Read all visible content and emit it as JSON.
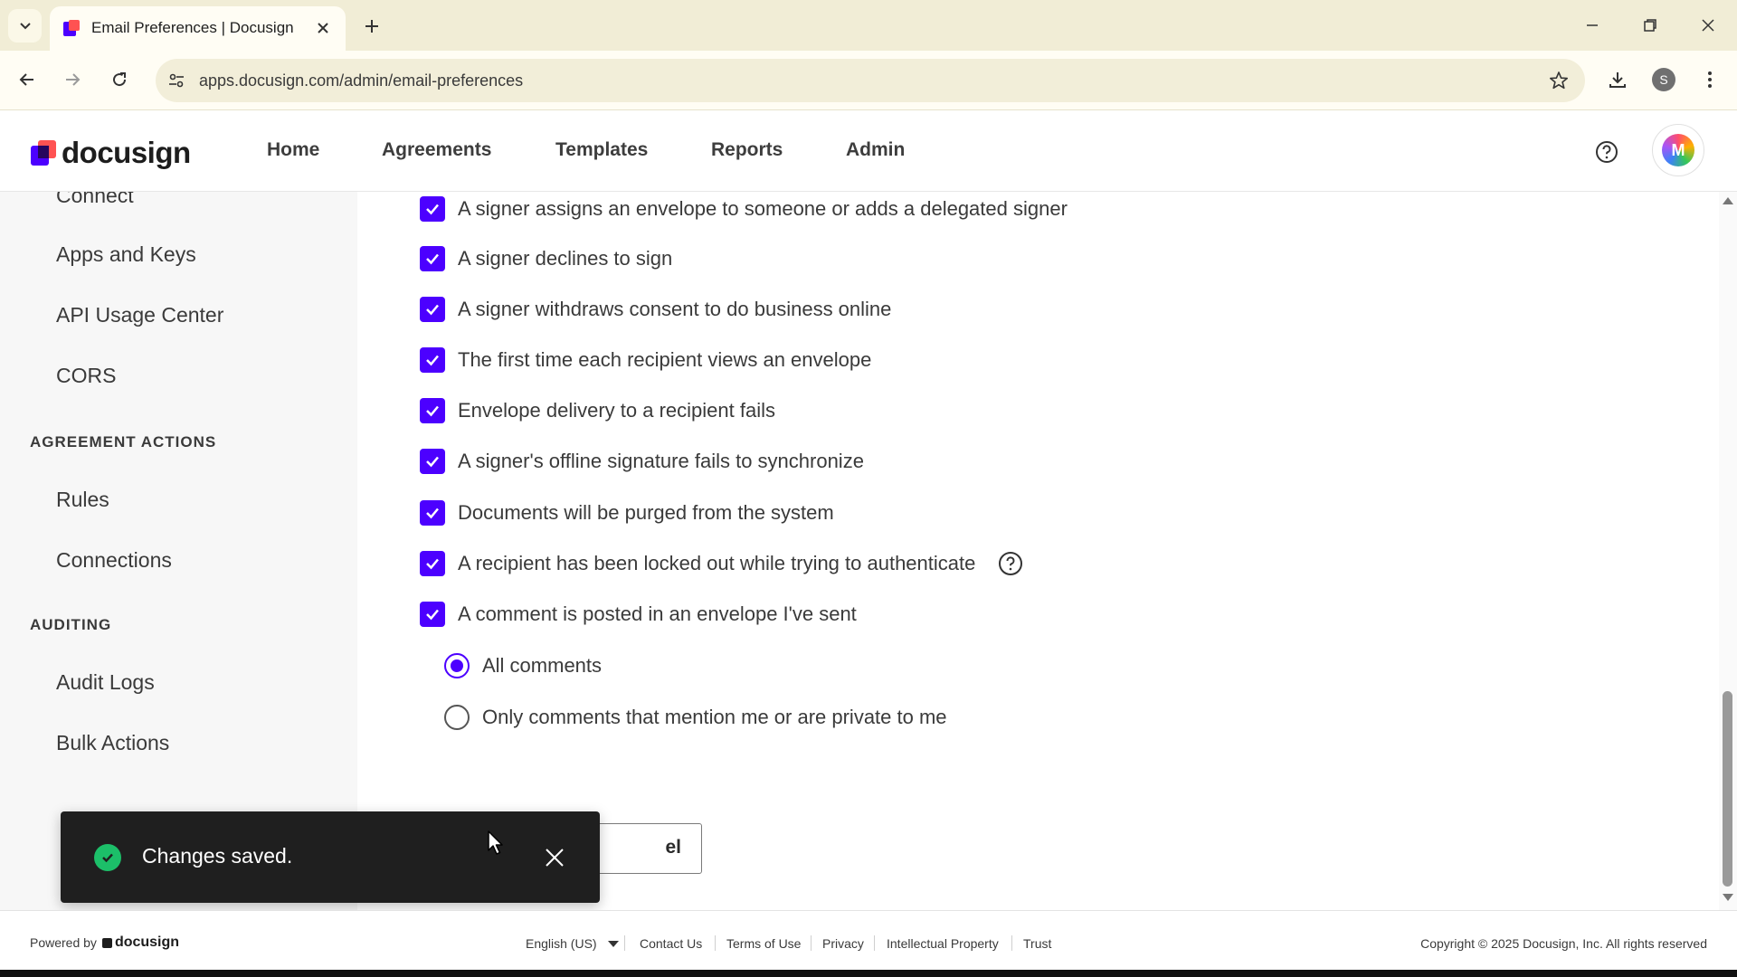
{
  "browser": {
    "tab_title": "Email Preferences | Docusign",
    "url": "apps.docusign.com/admin/email-preferences",
    "profile_initial": "S"
  },
  "header": {
    "logo_text": "docusign",
    "nav": [
      "Home",
      "Agreements",
      "Templates",
      "Reports",
      "Admin"
    ],
    "avatar_initial": "M"
  },
  "sidebar": {
    "items_top": [
      "Connect",
      "Apps and Keys",
      "API Usage Center",
      "CORS"
    ],
    "sections": [
      {
        "title": "AGREEMENT ACTIONS",
        "items": [
          "Rules",
          "Connections"
        ]
      },
      {
        "title": "AUDITING",
        "items": [
          "Audit Logs",
          "Bulk Actions"
        ]
      }
    ]
  },
  "main": {
    "options": [
      {
        "label": "A signer assigns an envelope to someone or adds a delegated signer",
        "checked": true
      },
      {
        "label": "A signer declines to sign",
        "checked": true
      },
      {
        "label": "A signer withdraws consent to do business online",
        "checked": true
      },
      {
        "label": "The first time each recipient views an envelope",
        "checked": true
      },
      {
        "label": "Envelope delivery to a recipient fails",
        "checked": true
      },
      {
        "label": "A signer's offline signature fails to synchronize",
        "checked": true
      },
      {
        "label": "Documents will be purged from the system",
        "checked": true
      },
      {
        "label": "A recipient has been locked out while trying to authenticate",
        "checked": true
      },
      {
        "label": "A comment is posted in an envelope I've sent",
        "checked": true
      }
    ],
    "comment_options": [
      {
        "label": "All comments",
        "selected": true
      },
      {
        "label": "Only comments that mention me or are private to me",
        "selected": false
      }
    ],
    "cancel_visible_text": "el"
  },
  "toast": {
    "message": "Changes saved."
  },
  "footer": {
    "powered_by": "Powered by",
    "logo_text": "docusign",
    "language": "English (US)",
    "links": [
      "Contact Us",
      "Terms of Use",
      "Privacy",
      "Intellectual Property",
      "Trust"
    ],
    "copyright": "Copyright © 2025 Docusign, Inc. All rights reserved"
  },
  "colors": {
    "accent": "#4c00ff",
    "toast_bg": "#1f1f1f",
    "success": "#1cbf69",
    "chrome_bg": "#f1edd6"
  }
}
